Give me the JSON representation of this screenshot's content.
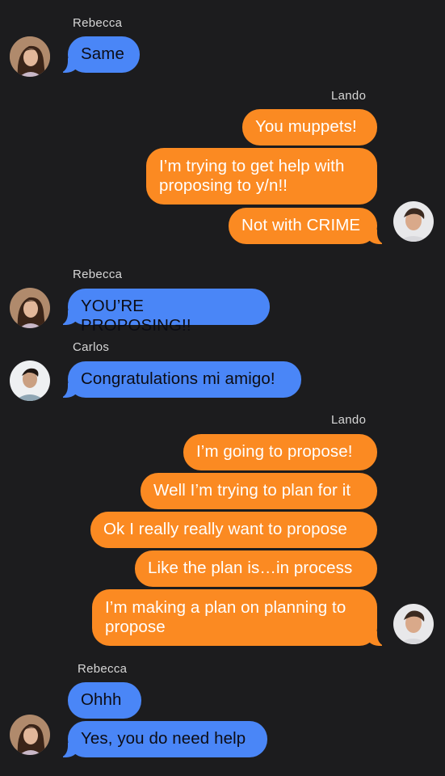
{
  "colors": {
    "background": "#1c1c1e",
    "incoming_bubble": "#4a86f7",
    "outgoing_bubble": "#fb8a22"
  },
  "avatars": {
    "rebecca": "woman-portrait-avatar",
    "lando": "man-portrait-avatar",
    "carlos": "man-portrait-avatar"
  },
  "messages": {
    "g1": {
      "sender": "Rebecca",
      "m1": "Same"
    },
    "g2": {
      "sender": "Lando",
      "m1": "You muppets!",
      "m2": "I’m trying to get help with\nproposing to y/n!!",
      "m3": "Not with CRIME"
    },
    "g3": {
      "sender": "Rebecca",
      "m1": "YOU’RE PROPOSING!!"
    },
    "g4": {
      "sender": "Carlos",
      "m1": "Congratulations mi amigo!"
    },
    "g5": {
      "sender": "Lando",
      "m1": "I’m going to propose!",
      "m2": "Well I’m trying to plan for it",
      "m3": "Ok I really really want to propose",
      "m4": "Like the plan is…in process",
      "m5": "I’m making a plan on planning to\npropose"
    },
    "g6": {
      "sender": "Rebecca",
      "m1": "Ohhh",
      "m2": "Yes, you do need help"
    }
  }
}
